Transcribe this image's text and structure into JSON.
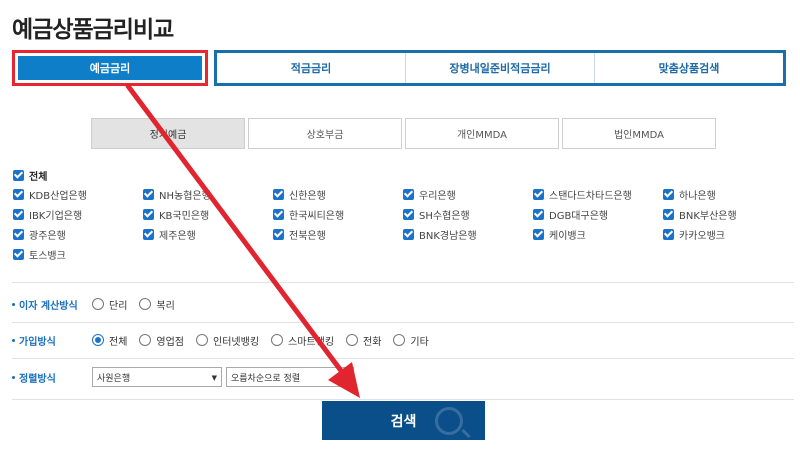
{
  "page_title": "예금상품금리비교",
  "main_tabs": {
    "active": "예금금리",
    "others": [
      "적금금리",
      "장병내일준비적금금리",
      "맞춤상품검색"
    ]
  },
  "sub_tabs": [
    "정기예금",
    "상호부금",
    "개인MMDA",
    "법인MMDA"
  ],
  "banks": {
    "all_label": "전체",
    "items": [
      "KDB산업은행",
      "NH농협은행",
      "신한은행",
      "우리은행",
      "스탠다드차타드은행",
      "하나은행",
      "IBK기업은행",
      "KB국민은행",
      "한국씨티은행",
      "SH수협은행",
      "DGB대구은행",
      "BNK부산은행",
      "광주은행",
      "제주은행",
      "전북은행",
      "BNK경남은행",
      "케이뱅크",
      "카카오뱅크",
      "토스뱅크"
    ]
  },
  "interest_method": {
    "label": "이자 계산방식",
    "options": [
      "단리",
      "복리"
    ]
  },
  "join_method": {
    "label": "가입방식",
    "options": [
      "전체",
      "영업점",
      "인터넷뱅킹",
      "스마트뱅킹",
      "전화",
      "기타"
    ]
  },
  "sort_method": {
    "label": "정렬방식",
    "select1": "사원은행",
    "select2": "오름차순으로 정렬"
  },
  "search_label": "검색",
  "colors": {
    "accent": "#0d7ec7",
    "highlight": "#e8262f",
    "search_button": "#0b4f8a"
  }
}
